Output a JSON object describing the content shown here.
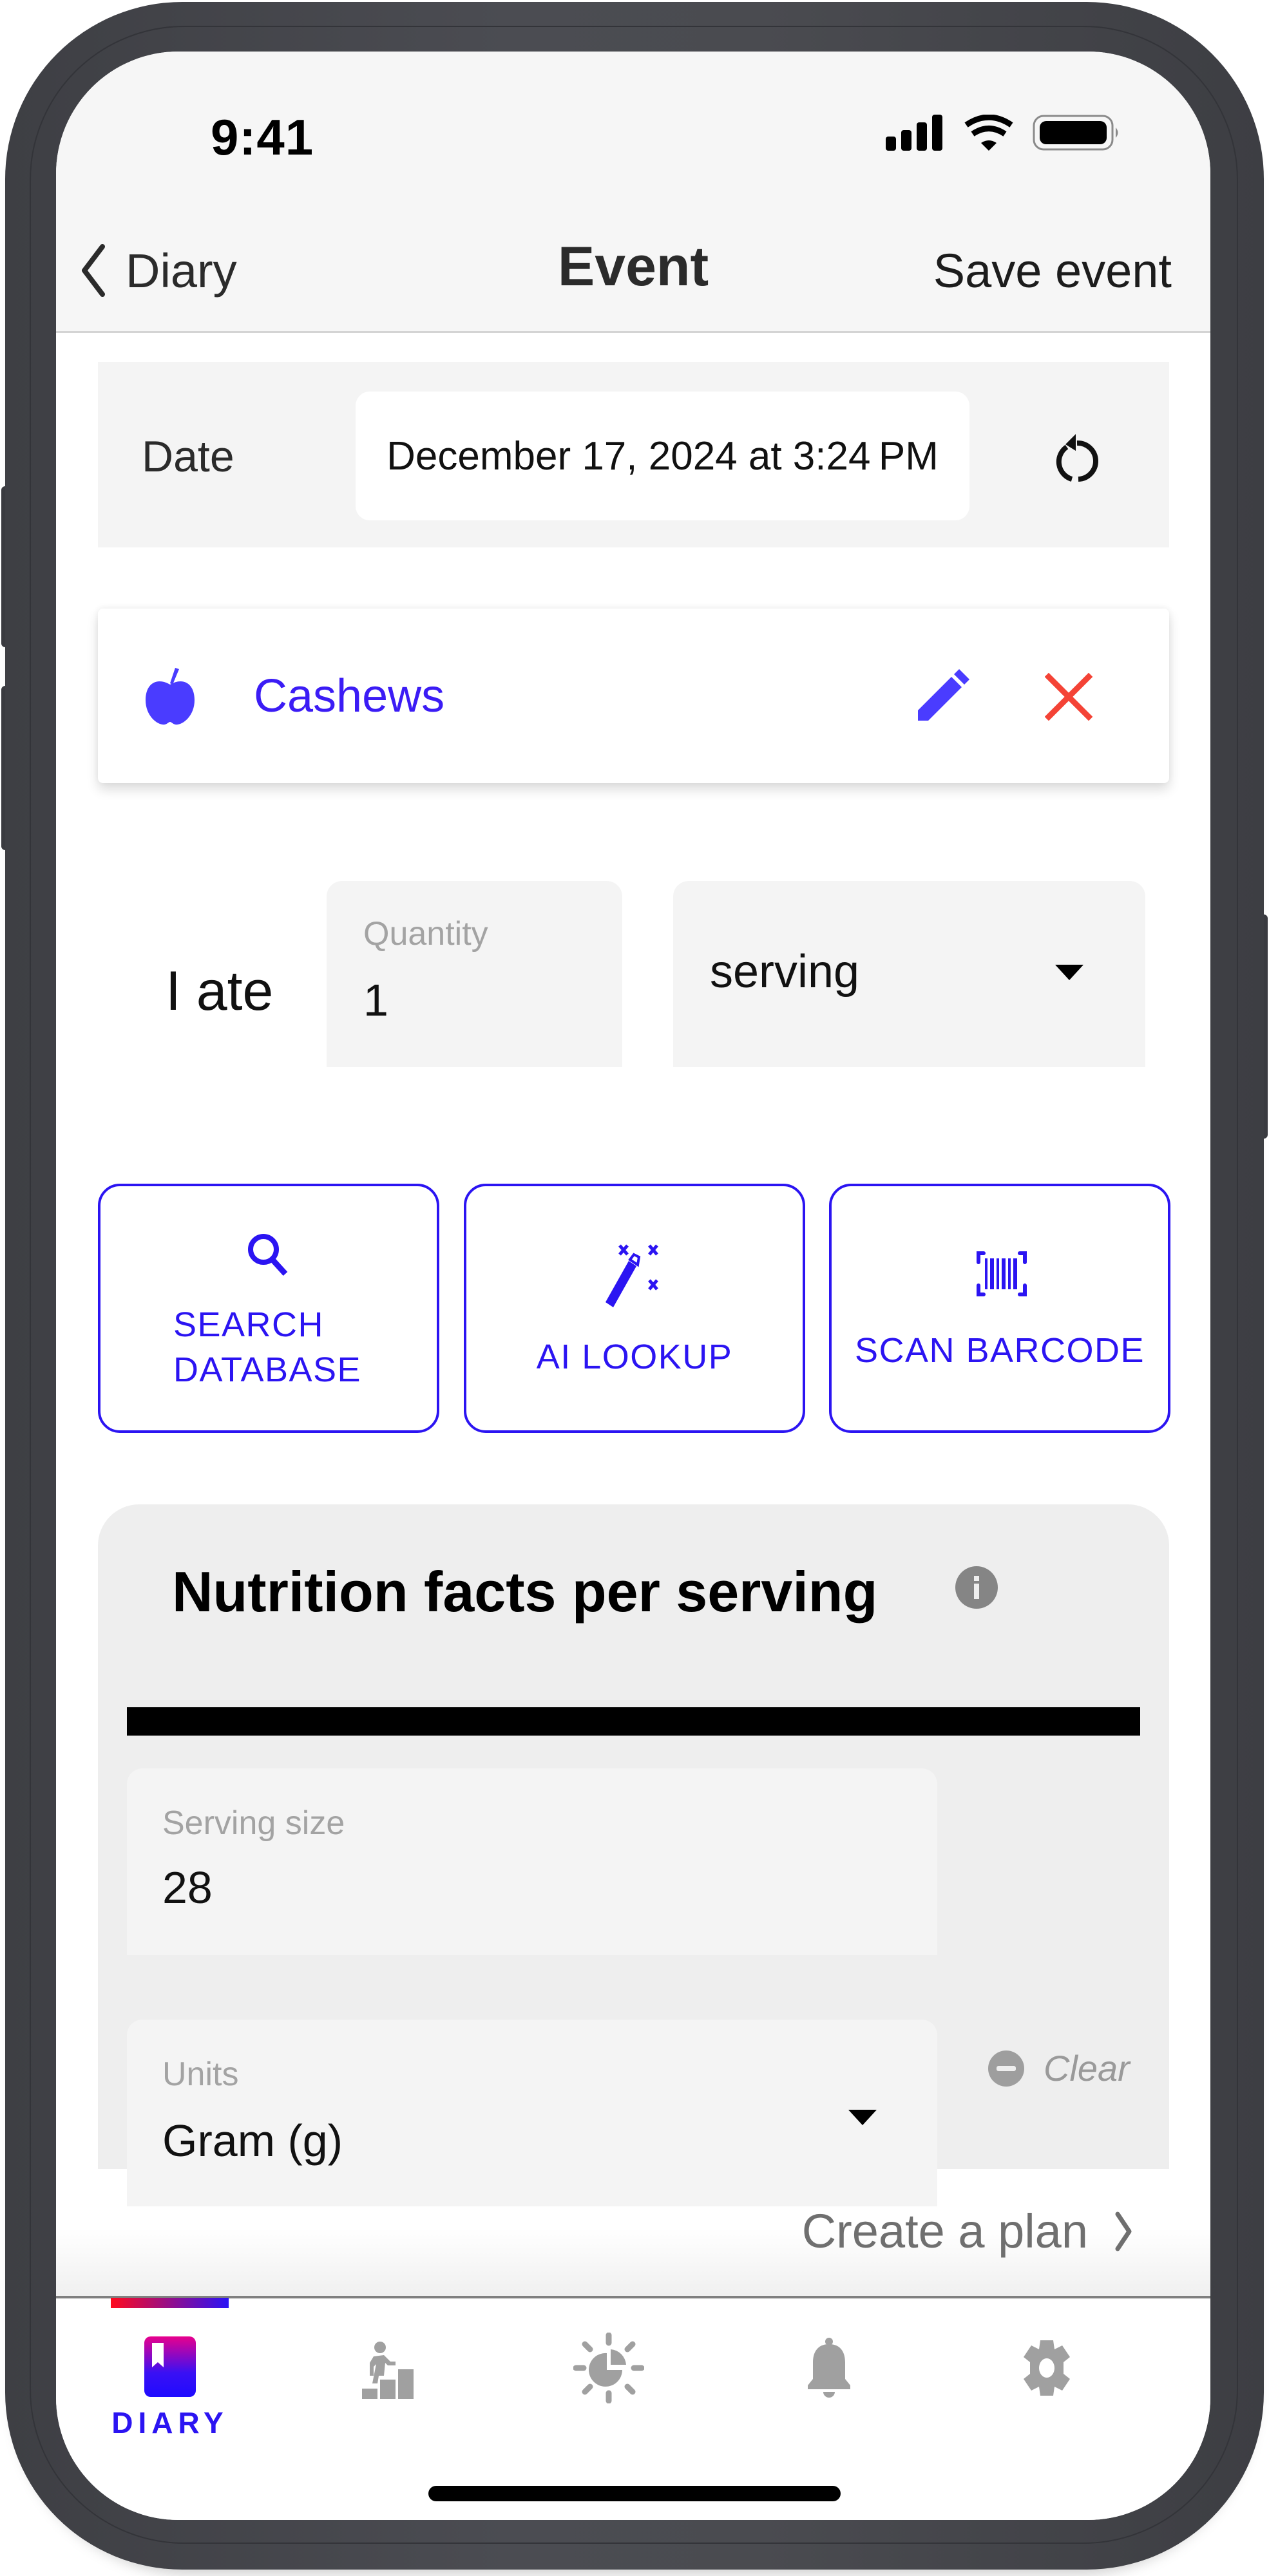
{
  "status_bar": {
    "time": "9:41",
    "icons": [
      "cellular-signal-icon",
      "wifi-icon",
      "battery-icon"
    ]
  },
  "nav": {
    "back_label": "Diary",
    "title": "Event",
    "save_label": "Save event"
  },
  "date_row": {
    "label": "Date",
    "value": "December 17, 2024 at 3:24 PM",
    "reset_icon": "rotate-ccw-icon"
  },
  "food": {
    "name": "Cashews",
    "icon": "apple-icon",
    "edit_icon": "pencil-icon",
    "remove_icon": "close-icon"
  },
  "intake": {
    "prefix": "I ate",
    "quantity_label": "Quantity",
    "quantity_value": "1",
    "unit_value": "serving"
  },
  "actions": [
    {
      "id": "search-database",
      "label_line1": "SEARCH",
      "label_line2": "DATABASE",
      "icon": "search-icon"
    },
    {
      "id": "ai-lookup",
      "label_line1": "AI LOOKUP",
      "label_line2": "",
      "icon": "magic-wand-icon"
    },
    {
      "id": "scan-barcode",
      "label_line1": "SCAN BARCODE",
      "label_line2": "",
      "icon": "barcode-scan-icon"
    }
  ],
  "nutrition": {
    "title": "Nutrition facts per serving",
    "serving_size_label": "Serving size",
    "serving_size_value": "28",
    "units_label": "Units",
    "units_value": "Gram (g)",
    "clear_label": "Clear"
  },
  "create_plan": {
    "label": "Create a plan"
  },
  "tabbar": {
    "active": "diary",
    "tabs": [
      {
        "id": "diary",
        "label": "DIARY",
        "icon": "diary-book-icon"
      },
      {
        "id": "progress",
        "label": "",
        "icon": "stairs-climb-icon"
      },
      {
        "id": "insights",
        "label": "",
        "icon": "sun-chart-icon"
      },
      {
        "id": "notifications",
        "label": "",
        "icon": "bell-icon"
      },
      {
        "id": "settings",
        "label": "",
        "icon": "gear-icon"
      }
    ]
  },
  "colors": {
    "accent": "#2b14f2",
    "food_name": "#3b1cf5",
    "remove": "#f44336",
    "muted": "#9e9e9e",
    "tab_indicator_start": "#ff0a1e",
    "tab_indicator_end": "#2a12f6"
  }
}
